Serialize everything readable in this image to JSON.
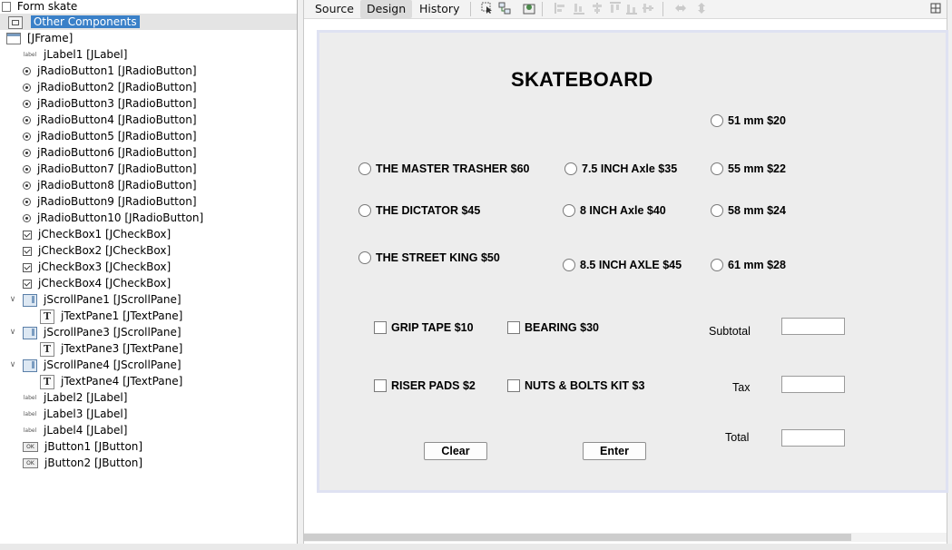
{
  "navigator": {
    "form_title": "Form skate",
    "other_components": "Other Components",
    "items": [
      {
        "label": "[JFrame]",
        "icon": "frame-icon"
      },
      {
        "label": "jLabel1 [JLabel]",
        "icon": "label-icon"
      },
      {
        "label": "jRadioButton1 [JRadioButton]",
        "icon": "radio-icon"
      },
      {
        "label": "jRadioButton2 [JRadioButton]",
        "icon": "radio-icon"
      },
      {
        "label": "jRadioButton3 [JRadioButton]",
        "icon": "radio-icon"
      },
      {
        "label": "jRadioButton4 [JRadioButton]",
        "icon": "radio-icon"
      },
      {
        "label": "jRadioButton5 [JRadioButton]",
        "icon": "radio-icon"
      },
      {
        "label": "jRadioButton6 [JRadioButton]",
        "icon": "radio-icon"
      },
      {
        "label": "jRadioButton7 [JRadioButton]",
        "icon": "radio-icon"
      },
      {
        "label": "jRadioButton8 [JRadioButton]",
        "icon": "radio-icon"
      },
      {
        "label": "jRadioButton9 [JRadioButton]",
        "icon": "radio-icon"
      },
      {
        "label": "jRadioButton10 [JRadioButton]",
        "icon": "radio-icon"
      },
      {
        "label": "jCheckBox1 [JCheckBox]",
        "icon": "checkbox-icon"
      },
      {
        "label": "jCheckBox2 [JCheckBox]",
        "icon": "checkbox-icon"
      },
      {
        "label": "jCheckBox3 [JCheckBox]",
        "icon": "checkbox-icon"
      },
      {
        "label": "jCheckBox4 [JCheckBox]",
        "icon": "checkbox-icon"
      },
      {
        "label": "jScrollPane1 [JScrollPane]",
        "icon": "scrollpane-icon"
      },
      {
        "label": "jTextPane1 [JTextPane]",
        "icon": "textpane-icon"
      },
      {
        "label": "jScrollPane3 [JScrollPane]",
        "icon": "scrollpane-icon"
      },
      {
        "label": "jTextPane3 [JTextPane]",
        "icon": "textpane-icon"
      },
      {
        "label": "jScrollPane4 [JScrollPane]",
        "icon": "scrollpane-icon"
      },
      {
        "label": "jTextPane4 [JTextPane]",
        "icon": "textpane-icon"
      },
      {
        "label": "jLabel2 [JLabel]",
        "icon": "label-icon"
      },
      {
        "label": "jLabel3 [JLabel]",
        "icon": "label-icon"
      },
      {
        "label": "jLabel4 [JLabel]",
        "icon": "label-icon"
      },
      {
        "label": "jButton1 [JButton]",
        "icon": "button-icon"
      },
      {
        "label": "jButton2 [JButton]",
        "icon": "button-icon"
      }
    ],
    "icon_text": {
      "label": "label",
      "button": "OK",
      "textpane": "T"
    }
  },
  "editor": {
    "tabs": [
      {
        "label": "Source"
      },
      {
        "label": "Design",
        "active": true
      },
      {
        "label": "History"
      }
    ]
  },
  "form": {
    "title": "SKATEBOARD",
    "decks": [
      "THE MASTER TRASHER $60",
      "THE DICTATOR $45",
      "THE STREET KING $50"
    ],
    "axles": [
      "7.5 INCH Axle $35",
      "8 INCH Axle $40",
      "8.5 INCH AXLE $45"
    ],
    "wheels": [
      "51 mm $20",
      "55 mm $22",
      "58 mm $24",
      "61 mm $28"
    ],
    "extras": [
      "GRIP TAPE $10",
      "BEARING $30",
      "RISER PADS $2",
      "NUTS & BOLTS KIT $3"
    ],
    "labels": {
      "subtotal": "Subtotal",
      "tax": "Tax",
      "total": "Total"
    },
    "fields": {
      "subtotal": "",
      "tax": "",
      "total": ""
    },
    "buttons": {
      "clear": "Clear",
      "enter": "Enter"
    }
  },
  "colors": {
    "selection": "#3a80c8",
    "form_border": "#dfe2f2",
    "form_bg": "#ededed"
  }
}
